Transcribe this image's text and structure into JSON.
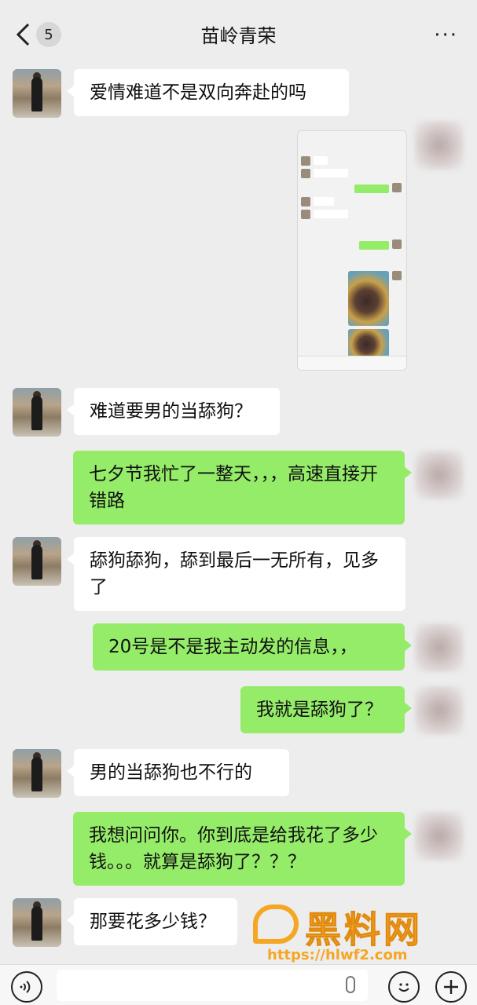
{
  "header": {
    "back_count": "5",
    "title": "苗岭青荣",
    "more": "···"
  },
  "messages": [
    {
      "side": "left",
      "text": "爱情难道不是双向奔赴的吗"
    },
    {
      "side": "right",
      "type": "image",
      "text": ""
    },
    {
      "side": "left",
      "text": "难道要男的当舔狗？"
    },
    {
      "side": "right",
      "text": "七夕节我忙了一整天，，，高速直接开错路"
    },
    {
      "side": "left",
      "text": "舔狗舔狗，舔到最后一无所有，见多了"
    },
    {
      "side": "right",
      "text": "20号是不是我主动发的信息，，"
    },
    {
      "side": "right",
      "text": "我就是舔狗了？"
    },
    {
      "side": "left",
      "text": "男的当舔狗也不行的"
    },
    {
      "side": "right",
      "text": "我想问问你。你到底是给我花了多少钱。。。就算是舔狗了？？？"
    },
    {
      "side": "left",
      "text": "那要花多少钱？"
    }
  ],
  "watermark": {
    "name": "黑料网",
    "url": "https://hlwf2.com"
  },
  "colors": {
    "bg": "#ededed",
    "sent_bubble": "#95ec69",
    "received_bubble": "#ffffff",
    "watermark": "#f5a623"
  }
}
